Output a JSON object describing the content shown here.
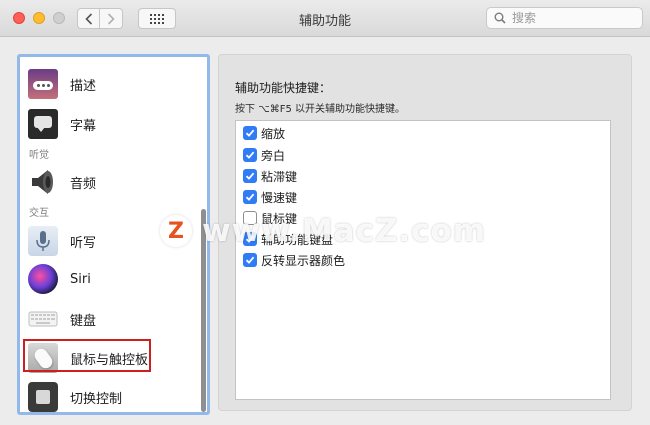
{
  "window": {
    "title": "辅助功能"
  },
  "search": {
    "placeholder": "搜索"
  },
  "sidebar": {
    "items": [
      {
        "label": "描述",
        "icon": "audio-description-icon"
      },
      {
        "label": "字幕",
        "icon": "captions-icon"
      },
      {
        "label": "音频",
        "icon": "speaker-icon"
      },
      {
        "label": "听写",
        "icon": "microphone-icon"
      },
      {
        "label": "Siri",
        "icon": "siri-icon"
      },
      {
        "label": "键盘",
        "icon": "keyboard-icon"
      },
      {
        "label": "鼠标与触控板",
        "icon": "mouse-icon"
      },
      {
        "label": "切换控制",
        "icon": "switch-control-icon"
      }
    ],
    "sections": [
      "听觉",
      "交互"
    ],
    "selected_highlight_color": "#cc1f1f",
    "focus_ring_color": "#93b8ea"
  },
  "main": {
    "heading": "辅助功能快捷键：",
    "hint": "按下 ⌥⌘F5 以开关辅助功能快捷键。",
    "options": [
      {
        "label": "缩放",
        "checked": true
      },
      {
        "label": "旁白",
        "checked": true
      },
      {
        "label": "粘滞键",
        "checked": true
      },
      {
        "label": "慢速键",
        "checked": true
      },
      {
        "label": "鼠标键",
        "checked": false
      },
      {
        "label": "辅助功能键盘",
        "checked": true
      },
      {
        "label": "反转显示器颜色",
        "checked": true
      }
    ],
    "checkbox_color": "#2f7cf6"
  },
  "watermark": {
    "text": "www.MacZ.com"
  }
}
